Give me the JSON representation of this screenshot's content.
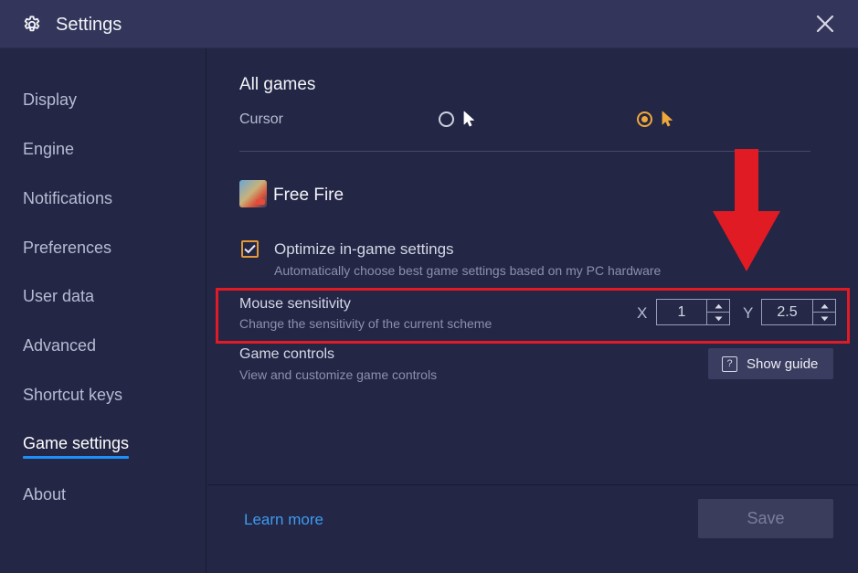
{
  "window": {
    "title": "Settings"
  },
  "sidebar": {
    "items": [
      {
        "label": "Display"
      },
      {
        "label": "Engine"
      },
      {
        "label": "Notifications"
      },
      {
        "label": "Preferences"
      },
      {
        "label": "User data"
      },
      {
        "label": "Advanced"
      },
      {
        "label": "Shortcut keys"
      },
      {
        "label": "Game settings",
        "active": true
      },
      {
        "label": "About"
      }
    ]
  },
  "all_games": {
    "title": "All games",
    "cursor_label": "Cursor",
    "cursor_options": [
      {
        "icon": "white-cursor-icon",
        "selected": false
      },
      {
        "icon": "orange-cursor-icon",
        "selected": true
      }
    ]
  },
  "game": {
    "name": "Free Fire",
    "optimize": {
      "label": "Optimize in-game settings",
      "description": "Automatically choose best game settings based on my PC hardware",
      "checked": true
    },
    "mouse_sensitivity": {
      "label": "Mouse sensitivity",
      "description": "Change the sensitivity of the current scheme",
      "x_label": "X",
      "x_value": "1",
      "y_label": "Y",
      "y_value": "2.5"
    },
    "game_controls": {
      "label": "Game controls",
      "description": "View and customize game controls",
      "button_label": "Show guide"
    }
  },
  "footer": {
    "learn_more": "Learn more",
    "save": "Save"
  },
  "colors": {
    "accent_blue": "#1f8ff5",
    "accent_orange": "#f0a83a",
    "highlight_red": "#e01b24",
    "background": "#232645"
  }
}
